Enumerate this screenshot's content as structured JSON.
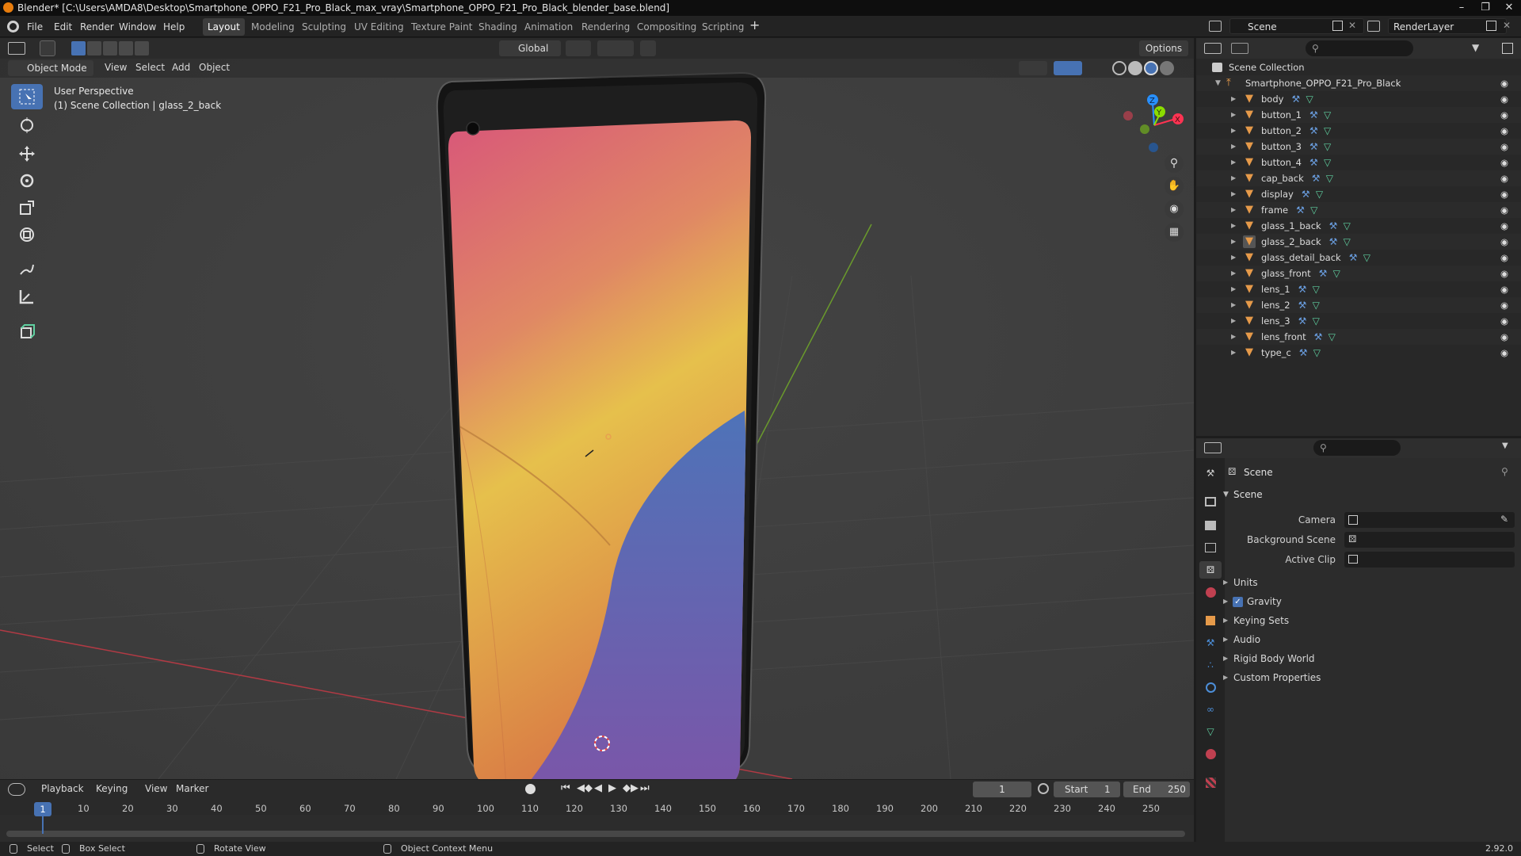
{
  "window": {
    "title": "Blender* [C:\\Users\\AMDA8\\Desktop\\Smartphone_OPPO_F21_Pro_Black_max_vray\\Smartphone_OPPO_F21_Pro_Black_blender_base.blend]"
  },
  "menu": [
    "File",
    "Edit",
    "Render",
    "Window",
    "Help"
  ],
  "workspaces": [
    "Layout",
    "Modeling",
    "Sculpting",
    "UV Editing",
    "Texture Paint",
    "Shading",
    "Animation",
    "Rendering",
    "Compositing",
    "Scripting"
  ],
  "active_workspace": "Layout",
  "scene_field": "Scene",
  "view_layer_field": "RenderLayer",
  "viewport": {
    "mode": "Object Mode",
    "menus": [
      "View",
      "Select",
      "Add",
      "Object"
    ],
    "orientation": "Global",
    "options_label": "Options",
    "overlay_title": "User Perspective",
    "overlay_subtitle": "(1) Scene Collection | glass_2_back",
    "gizmo_axes": [
      "Z",
      "Y",
      "X"
    ]
  },
  "outliner": {
    "root": "Scene Collection",
    "collection": "Smartphone_OPPO_F21_Pro_Black",
    "objects": [
      "body",
      "button_1",
      "button_2",
      "button_3",
      "button_4",
      "cap_back",
      "display",
      "frame",
      "glass_1_back",
      "glass_2_back",
      "glass_detail_back",
      "glass_front",
      "lens_1",
      "lens_2",
      "lens_3",
      "lens_front",
      "type_c"
    ],
    "active_object": "glass_2_back"
  },
  "properties": {
    "context": "Scene",
    "panel_title": "Scene",
    "fields": [
      {
        "label": "Camera",
        "value": ""
      },
      {
        "label": "Background Scene",
        "value": ""
      },
      {
        "label": "Active Clip",
        "value": ""
      }
    ],
    "sections": [
      "Units",
      "Gravity",
      "Keying Sets",
      "Audio",
      "Rigid Body World",
      "Custom Properties"
    ],
    "gravity_checked": true
  },
  "timeline": {
    "menus": [
      "Playback",
      "Keying",
      "View",
      "Marker"
    ],
    "current_frame": "1",
    "start_label": "Start",
    "start": "1",
    "end_label": "End",
    "end": "250",
    "ticks": [
      "10",
      "20",
      "30",
      "40",
      "50",
      "60",
      "70",
      "80",
      "90",
      "100",
      "110",
      "120",
      "130",
      "140",
      "150",
      "160",
      "170",
      "180",
      "190",
      "200",
      "210",
      "220",
      "230",
      "240",
      "250"
    ],
    "playhead_label": "1"
  },
  "statusbar": {
    "select": "Select",
    "box_select": "Box Select",
    "rotate_view": "Rotate View",
    "context_menu": "Object Context Menu",
    "version": "2.92.0"
  },
  "colors": {
    "accent": "#4772b3",
    "object_orange": "#e69a4a",
    "mesh_green": "#5fd0a0",
    "axis_x": "#ff3352",
    "axis_y": "#8bdc00",
    "axis_z": "#2890ff"
  }
}
